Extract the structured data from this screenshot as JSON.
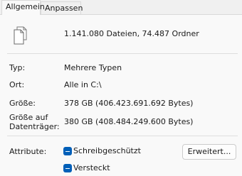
{
  "tabs": [
    {
      "label": "Allgemein"
    },
    {
      "label": "Anpassen"
    }
  ],
  "summary": {
    "icon": "multiple-files-icon",
    "count_text": "1.141.080 Dateien, 74.487 Ordner"
  },
  "properties": {
    "type_label": "Typ:",
    "type_value": "Mehrere Typen",
    "location_label": "Ort:",
    "location_value": "Alle in C:\\",
    "size_label": "Größe:",
    "size_value": "378 GB (406.423.691.692 Bytes)",
    "disk_size_label_line1": "Größe auf",
    "disk_size_label_line2": "Datenträger:",
    "disk_size_value": "380 GB (408.484.249.600 Bytes)"
  },
  "attributes": {
    "label": "Attribute:",
    "readonly_label": "Schreibgeschützt",
    "readonly_state": "indeterminate",
    "hidden_label": "Versteckt",
    "hidden_state": "indeterminate",
    "advanced_button": "Erweitert..."
  },
  "colors": {
    "checkbox_accent": "#005fb8",
    "panel_background": "#f9f9f9",
    "window_background": "#f0f0f0"
  }
}
